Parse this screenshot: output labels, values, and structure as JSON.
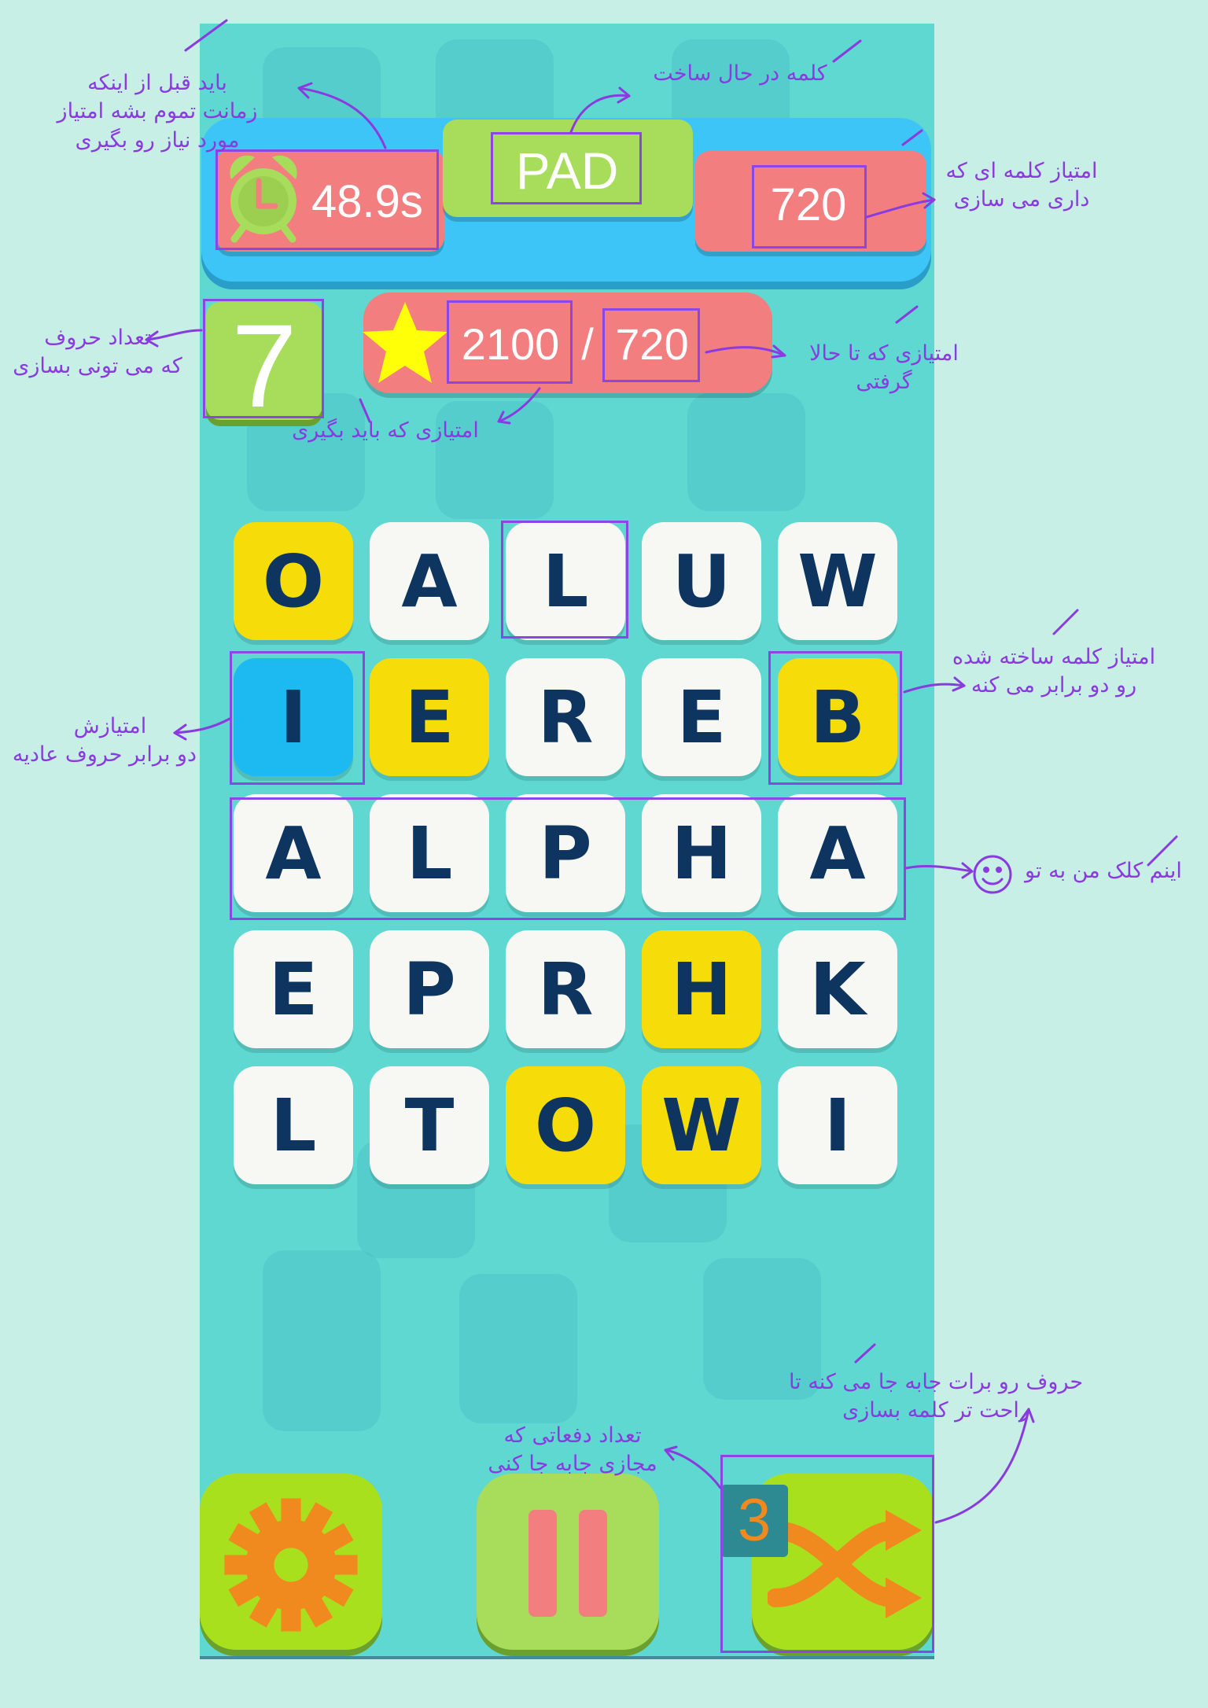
{
  "timer": {
    "value": "48.9s"
  },
  "current_word": {
    "value": "PAD"
  },
  "word_score": {
    "value": "720"
  },
  "letters_needed": {
    "value": "7"
  },
  "progress": {
    "target": "2100",
    "separator": "/",
    "current": "720"
  },
  "grid": [
    [
      {
        "l": "O",
        "c": "yellow"
      },
      {
        "l": "A",
        "c": "white"
      },
      {
        "l": "L",
        "c": "white"
      },
      {
        "l": "U",
        "c": "white"
      },
      {
        "l": "W",
        "c": "white"
      }
    ],
    [
      {
        "l": "I",
        "c": "blue"
      },
      {
        "l": "E",
        "c": "yellow"
      },
      {
        "l": "R",
        "c": "white"
      },
      {
        "l": "E",
        "c": "white"
      },
      {
        "l": "B",
        "c": "yellow"
      }
    ],
    [
      {
        "l": "A",
        "c": "white"
      },
      {
        "l": "L",
        "c": "white"
      },
      {
        "l": "P",
        "c": "white"
      },
      {
        "l": "H",
        "c": "white"
      },
      {
        "l": "A",
        "c": "white"
      }
    ],
    [
      {
        "l": "E",
        "c": "white"
      },
      {
        "l": "P",
        "c": "white"
      },
      {
        "l": "R",
        "c": "white"
      },
      {
        "l": "H",
        "c": "yellow"
      },
      {
        "l": "K",
        "c": "white"
      }
    ],
    [
      {
        "l": "L",
        "c": "white"
      },
      {
        "l": "T",
        "c": "white"
      },
      {
        "l": "O",
        "c": "yellow"
      },
      {
        "l": "W",
        "c": "yellow"
      },
      {
        "l": "I",
        "c": "white"
      }
    ]
  ],
  "shuffle": {
    "count": "3"
  },
  "icons": {
    "clock": "alarm-clock-icon",
    "star": "star-icon",
    "settings": "gear-icon",
    "pause": "pause-icon",
    "shuffle": "shuffle-icon"
  },
  "colors": {
    "background": "#c8efe6",
    "board": "#5ed8d1",
    "top_bar": "#3ec5f7",
    "panel_red": "#f27e80",
    "panel_green": "#a7dd5a",
    "tile_white": "#f7f7f3",
    "tile_yellow": "#f6dc08",
    "tile_blue": "#1dbaf2",
    "letter": "#0d3560",
    "button": "#a9e01e",
    "orange": "#f08a1e",
    "annotation": "#8a3be0"
  },
  "annotations": {
    "timer_note": [
      "باید قبل از اینکه",
      "زمانت تموم بشه امتیاز",
      "مورد نیاز رو بگیری"
    ],
    "word_note": [
      "کلمه در حال ساخت"
    ],
    "word_score_note": [
      "امتیاز کلمه ای که",
      "داری می سازی"
    ],
    "letters_note": [
      "تعداد حروف",
      "که می تونی بسازی"
    ],
    "current_score_note": [
      "امتیازی که تا حالا",
      "گرفتی"
    ],
    "target_note": [
      "امتیازی که باید بگیری"
    ],
    "special_note": [
      "امتیاز کلمه ساخته شده",
      "رو دو برابر می کنه"
    ],
    "blue_note": [
      "امتیازش",
      "دو برابر حروف عادیه"
    ],
    "row_note": [
      "اینم کلک من به تو"
    ],
    "shuffle_count_note": [
      "تعداد دفعاتی که",
      "مجازی جابه جا کنی"
    ],
    "shuffle_note": [
      "حروف رو برات جابه جا می کنه تا",
      "راحت تر کلمه بسازی"
    ]
  }
}
